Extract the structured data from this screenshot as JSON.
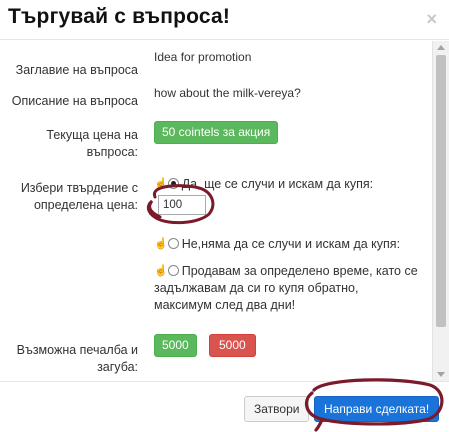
{
  "modal": {
    "title": "Търгувай с въпроса!",
    "close_glyph": "×"
  },
  "fields": {
    "question_title_label": "Заглавие на въпроса",
    "question_title_value": "Idea for promotion",
    "question_desc_label": "Описание на въпроса",
    "question_desc_value": "how about the milk-vereya?",
    "price_label_1": "Текуща цена на",
    "price_label_2": "въпроса:",
    "price_button": "50 cointels за акция",
    "choose_label_1": "Избери твърдение с",
    "choose_label_2": "определена цена:",
    "option_yes": "Да, ще се случи и искам да купя:",
    "option_yes_value": "100",
    "option_no": "Не,няма да се случи и искам да купя:",
    "option_sell_1": "Продавам за определено време, като се",
    "option_sell_2": "задължавам да си го купя обратно,",
    "option_sell_3": "максимум след два дни!",
    "profit_label_1": "Възможна печалба и",
    "profit_label_2": "загуба:",
    "profit_value": "5000",
    "loss_value": "5000"
  },
  "footer": {
    "close_button": "Затвори",
    "deal_button": "Направи сделката!"
  },
  "colors": {
    "accent_green": "#5cb85c",
    "accent_red": "#d9534f",
    "primary_blue": "#1a73d9",
    "annotation_maroon": "#7a1a2a"
  },
  "icons": {
    "hand": "hand-pointer-icon",
    "close": "close-icon"
  }
}
